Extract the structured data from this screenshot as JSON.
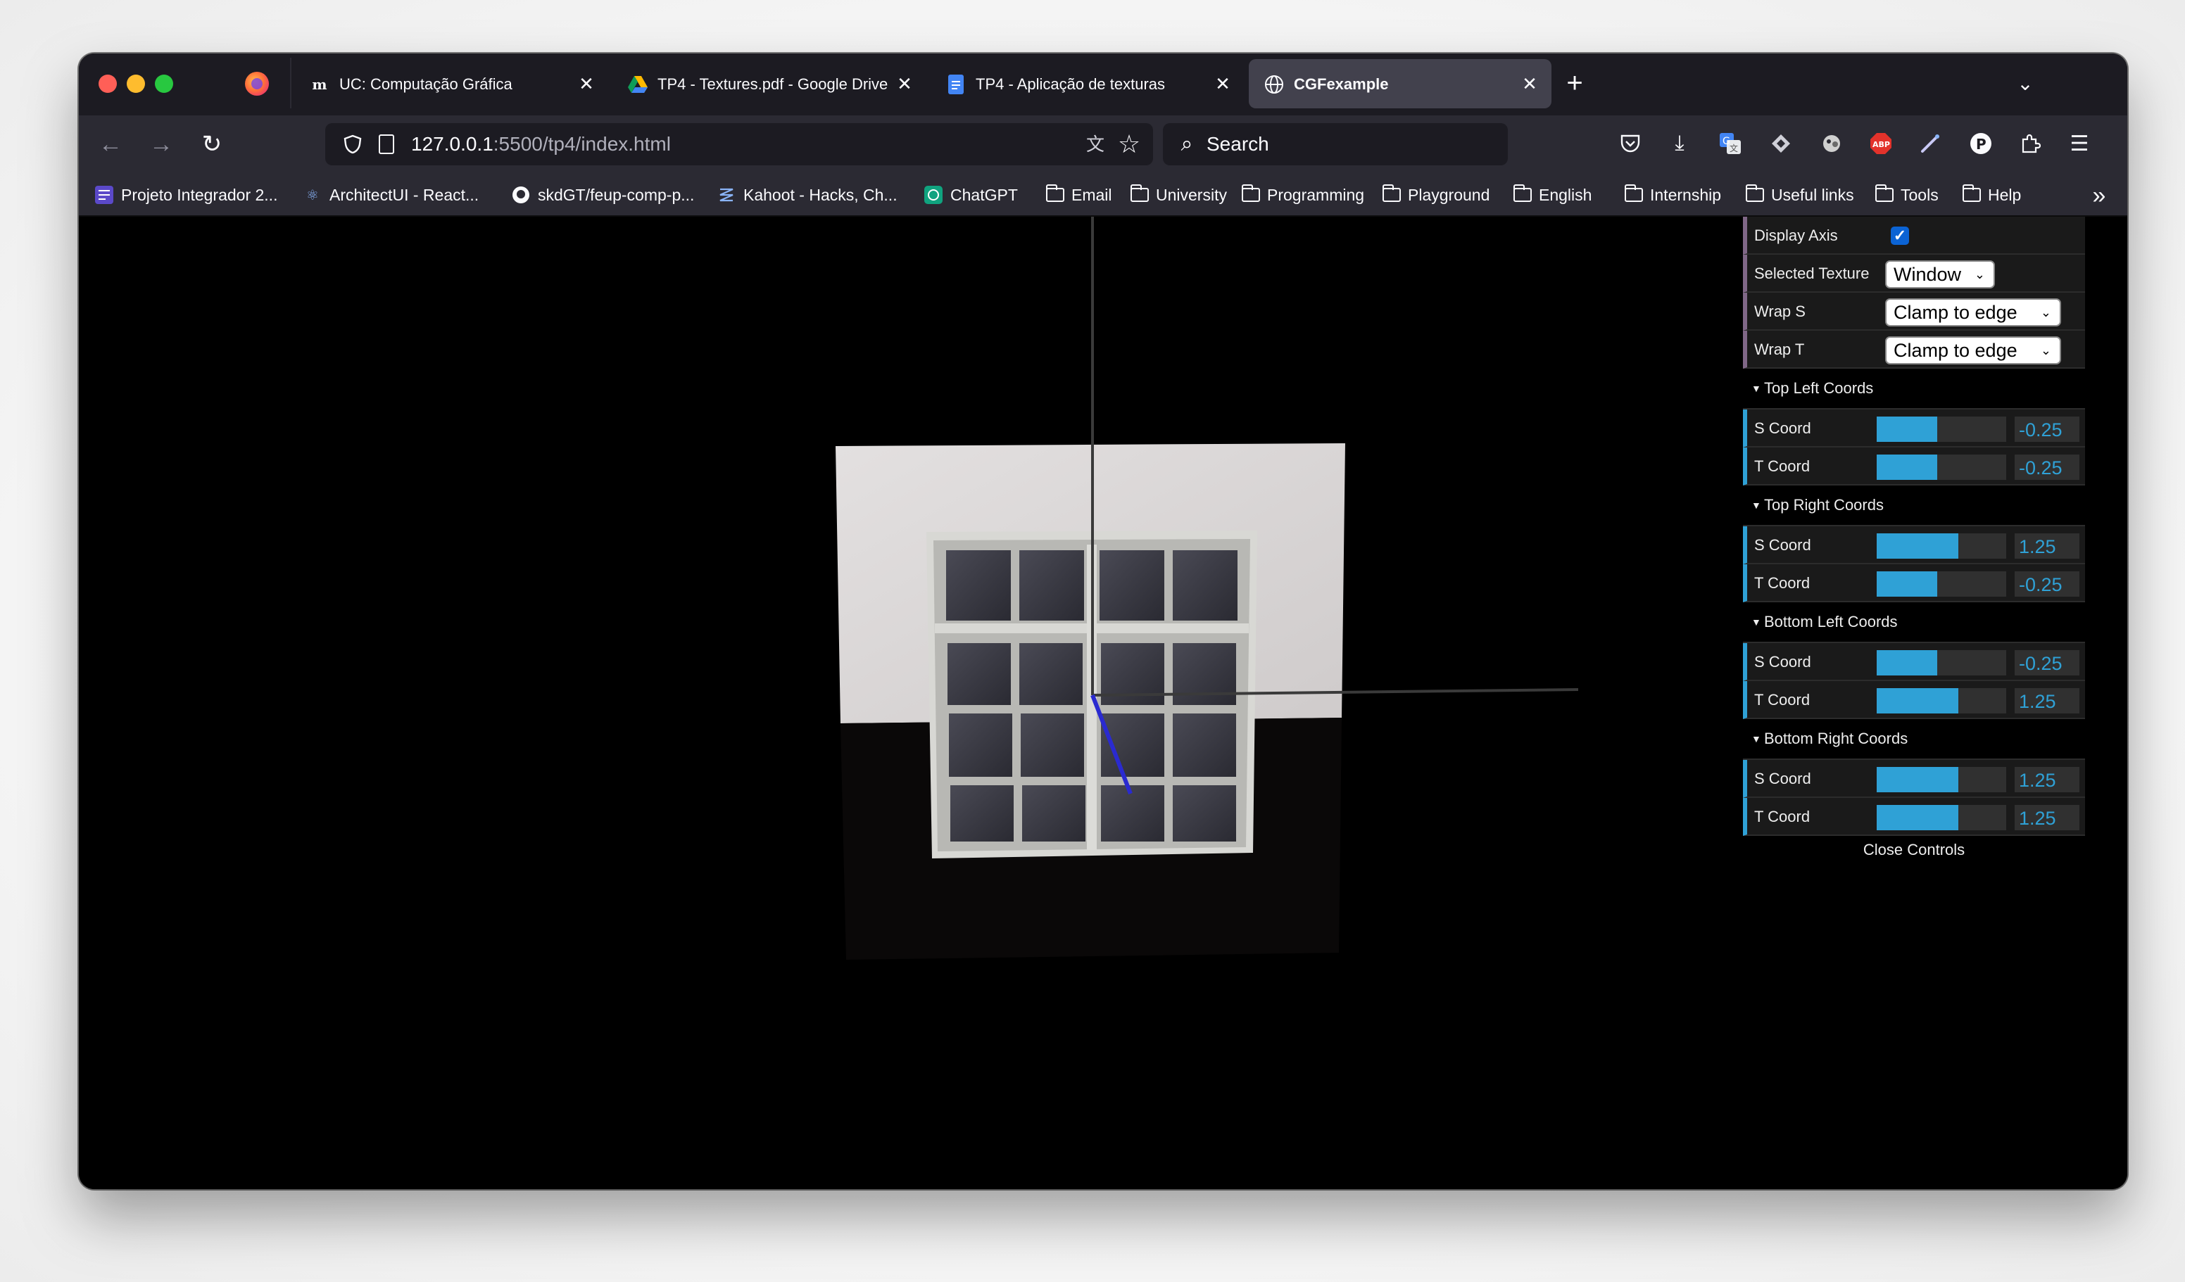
{
  "browser": {
    "tabs": [
      {
        "title": "UC: Computação Gráfica",
        "favicon": "sigarra-favicon",
        "active": false
      },
      {
        "title": "TP4 - Textures.pdf - Google Drive",
        "favicon": "google-drive-favicon",
        "active": false
      },
      {
        "title": "TP4 - Aplicação de texturas",
        "favicon": "google-docs-favicon",
        "active": false
      },
      {
        "title": "CGFexample",
        "favicon": "globe-favicon",
        "active": true
      }
    ],
    "url_host": "127.0.0.1",
    "url_rest": ":5500/tp4/index.html",
    "search_placeholder": "Search",
    "bookmarks": [
      {
        "label": "Projeto Integrador 2...",
        "icon": "trello-icon"
      },
      {
        "label": "ArchitectUI - React...",
        "icon": "react-icon"
      },
      {
        "label": "skdGT/feup-comp-p...",
        "icon": "github-icon"
      },
      {
        "label": "Kahoot - Hacks, Ch...",
        "icon": "kahoot-icon"
      },
      {
        "label": "ChatGPT",
        "icon": "chatgpt-icon"
      },
      {
        "label": "Email",
        "icon": "folder-icon"
      },
      {
        "label": "University",
        "icon": "folder-icon"
      },
      {
        "label": "Programming",
        "icon": "folder-icon"
      },
      {
        "label": "Playground",
        "icon": "folder-icon"
      },
      {
        "label": "English",
        "icon": "folder-icon"
      },
      {
        "label": "Internship",
        "icon": "folder-icon"
      },
      {
        "label": "Useful links",
        "icon": "folder-icon"
      },
      {
        "label": "Tools",
        "icon": "folder-icon"
      },
      {
        "label": "Help",
        "icon": "folder-icon"
      }
    ]
  },
  "gui": {
    "display_axis_label": "Display Axis",
    "display_axis_checked": true,
    "selected_texture_label": "Selected Texture",
    "selected_texture_value": "Window",
    "wrap_s_label": "Wrap S",
    "wrap_s_value": "Clamp to edge",
    "wrap_t_label": "Wrap T",
    "wrap_t_value": "Clamp to edge",
    "folders": [
      {
        "title": "Top Left Coords",
        "s_label": "S Coord",
        "s_value": "-0.25",
        "s_fraction": 0.47,
        "t_label": "T Coord",
        "t_value": "-0.25",
        "t_fraction": 0.47
      },
      {
        "title": "Top Right Coords",
        "s_label": "S Coord",
        "s_value": "1.25",
        "s_fraction": 0.63,
        "t_label": "T Coord",
        "t_value": "-0.25",
        "t_fraction": 0.47
      },
      {
        "title": "Bottom Left Coords",
        "s_label": "S Coord",
        "s_value": "-0.25",
        "s_fraction": 0.47,
        "t_label": "T Coord",
        "t_value": "1.25",
        "t_fraction": 0.63
      },
      {
        "title": "Bottom Right Coords",
        "s_label": "S Coord",
        "s_value": "1.25",
        "s_fraction": 0.63,
        "t_label": "T Coord",
        "t_value": "1.25",
        "t_fraction": 0.63
      }
    ],
    "close_label": "Close Controls"
  },
  "colors": {
    "gui_number_accent": "#2fa1d6",
    "gui_list_accent": "#806787",
    "axis_x": "#333333",
    "axis_y": "#333333",
    "axis_z": "#2222cc"
  }
}
